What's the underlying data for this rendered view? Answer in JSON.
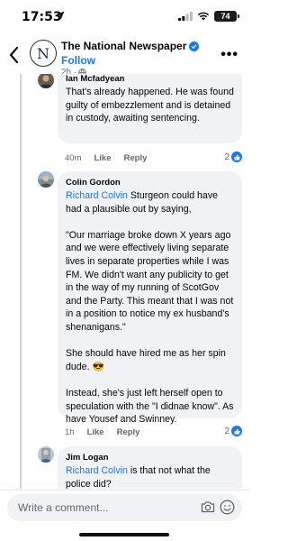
{
  "status_bar": {
    "time": "17:53",
    "battery": "74"
  },
  "header": {
    "logo_letter": "N",
    "page_name": "The National Newspaper",
    "follow_label": "Follow",
    "post_age": "2h ·"
  },
  "comments": [
    {
      "author": "Ian Mcfadyean",
      "text": "That's already happened. He was found guilty of embezzlement and is detained in custody, awaiting sentencing.",
      "age": "40m",
      "like_label": "Like",
      "reply_label": "Reply",
      "reaction_count": "2"
    },
    {
      "author": "Colin Gordon",
      "mention": "Richard Colvin",
      "text": " Sturgeon could have had a plausible out by saying,\n\n\"Our marriage broke down X years ago and we were effectively living separate lives in separate properties while I was FM. We didn't want any publicity to get in the way of my running of ScotGov and the Party. This meant that I was not in a position to notice my ex husband's shenanigans.\"\n\nShe should have hired me as her spin dude. 😎\n\nInstead, she's just left herself open to speculation with the \"I didnae know\". As have Yousef and Swinney.",
      "age": "1h",
      "like_label": "Like",
      "reply_label": "Reply",
      "reaction_count": "2"
    },
    {
      "author": "Jim Logan",
      "mention": "Richard Colvin",
      "text": " is that not what the police did?"
    }
  ],
  "composer": {
    "placeholder": "Write a comment..."
  },
  "colors": {
    "accent": "#1877f2",
    "bubble": "#f0f2f5",
    "muted": "#65676b"
  },
  "icons": [
    "location-arrow-icon",
    "signal-icon",
    "wifi-icon",
    "battery-icon",
    "back-chevron-icon",
    "verified-badge-icon",
    "globe-icon",
    "more-icon",
    "like-reaction-icon",
    "camera-icon",
    "emoji-icon"
  ]
}
